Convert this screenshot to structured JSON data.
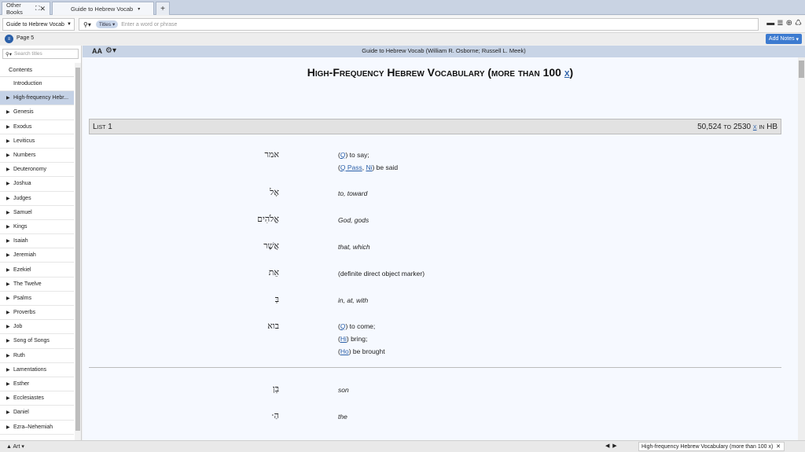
{
  "tabs": {
    "library": "Other Books",
    "active": "Guide to Hebrew Vocab",
    "new_tab": "+"
  },
  "toolbar": {
    "book": "Guide to Hebrew Vocab",
    "search_scope": "Titles",
    "search_placeholder": "Enter a word or phrase"
  },
  "pagebar": {
    "page": "Page 5",
    "add_notes": "Add Notes"
  },
  "sidebar": {
    "search_placeholder": "Search titles",
    "contents": "Contents",
    "items": [
      "Introduction",
      "High-frequency Hebr...",
      "Genesis",
      "Exodus",
      "Leviticus",
      "Numbers",
      "Deuteronomy",
      "Joshua",
      "Judges",
      "Samuel",
      "Kings",
      "Isaiah",
      "Jeremiah",
      "Ezekiel",
      "The Twelve",
      "Psalms",
      "Proverbs",
      "Job",
      "Song of Songs",
      "Ruth",
      "Lamentations",
      "Esther",
      "Ecclesiastes",
      "Daniel",
      "Ezra–Nehemiah"
    ],
    "selected_index": 1
  },
  "main": {
    "header_title": "Guide to Hebrew Vocab (William R. Osborne; Russell L. Meek)",
    "font_label": "AA",
    "doc_title": "High-Frequency Hebrew Vocabulary (more than 100 ",
    "doc_title_link": "x",
    "doc_title_end": ")",
    "list_label": "List 1",
    "list_range": "50,524 to 2530 ",
    "list_range_link": "x",
    "list_range_end": " in HB",
    "entries": [
      {
        "heb": "אמר",
        "l1a": "(",
        "l1link": "Q",
        "l1b": ") to say;",
        "l2a": "(",
        "l2link1": "Q Pass",
        "l2sep": ", ",
        "l2link2": "Ni",
        "l2b": ") be said"
      },
      {
        "heb": "אֶל",
        "gloss": "to, toward"
      },
      {
        "heb": "אֱלֹהִים",
        "gloss": "God, gods"
      },
      {
        "heb": "אֲשֶׁר",
        "gloss": "that, which"
      },
      {
        "heb": "אֵת",
        "gloss": "(definite direct object marker)"
      },
      {
        "heb": "בְּ",
        "gloss": "in, at, with"
      },
      {
        "heb": "בוא",
        "l1a": "(",
        "l1link": "Q",
        "l1b": ") to come;",
        "l2a": "(",
        "l2link": "Hi",
        "l2b": ") bring;",
        "l3a": "(",
        "l3link": "Ho",
        "l3b": ") be brought"
      },
      {
        "heb": "בֵּן",
        "gloss": "son"
      },
      {
        "heb": "הַ‧",
        "gloss": "the"
      }
    ]
  },
  "statusbar": {
    "art": "Art",
    "location": "High-frequency Hebrew Vocabulary (more than 100 x)"
  }
}
